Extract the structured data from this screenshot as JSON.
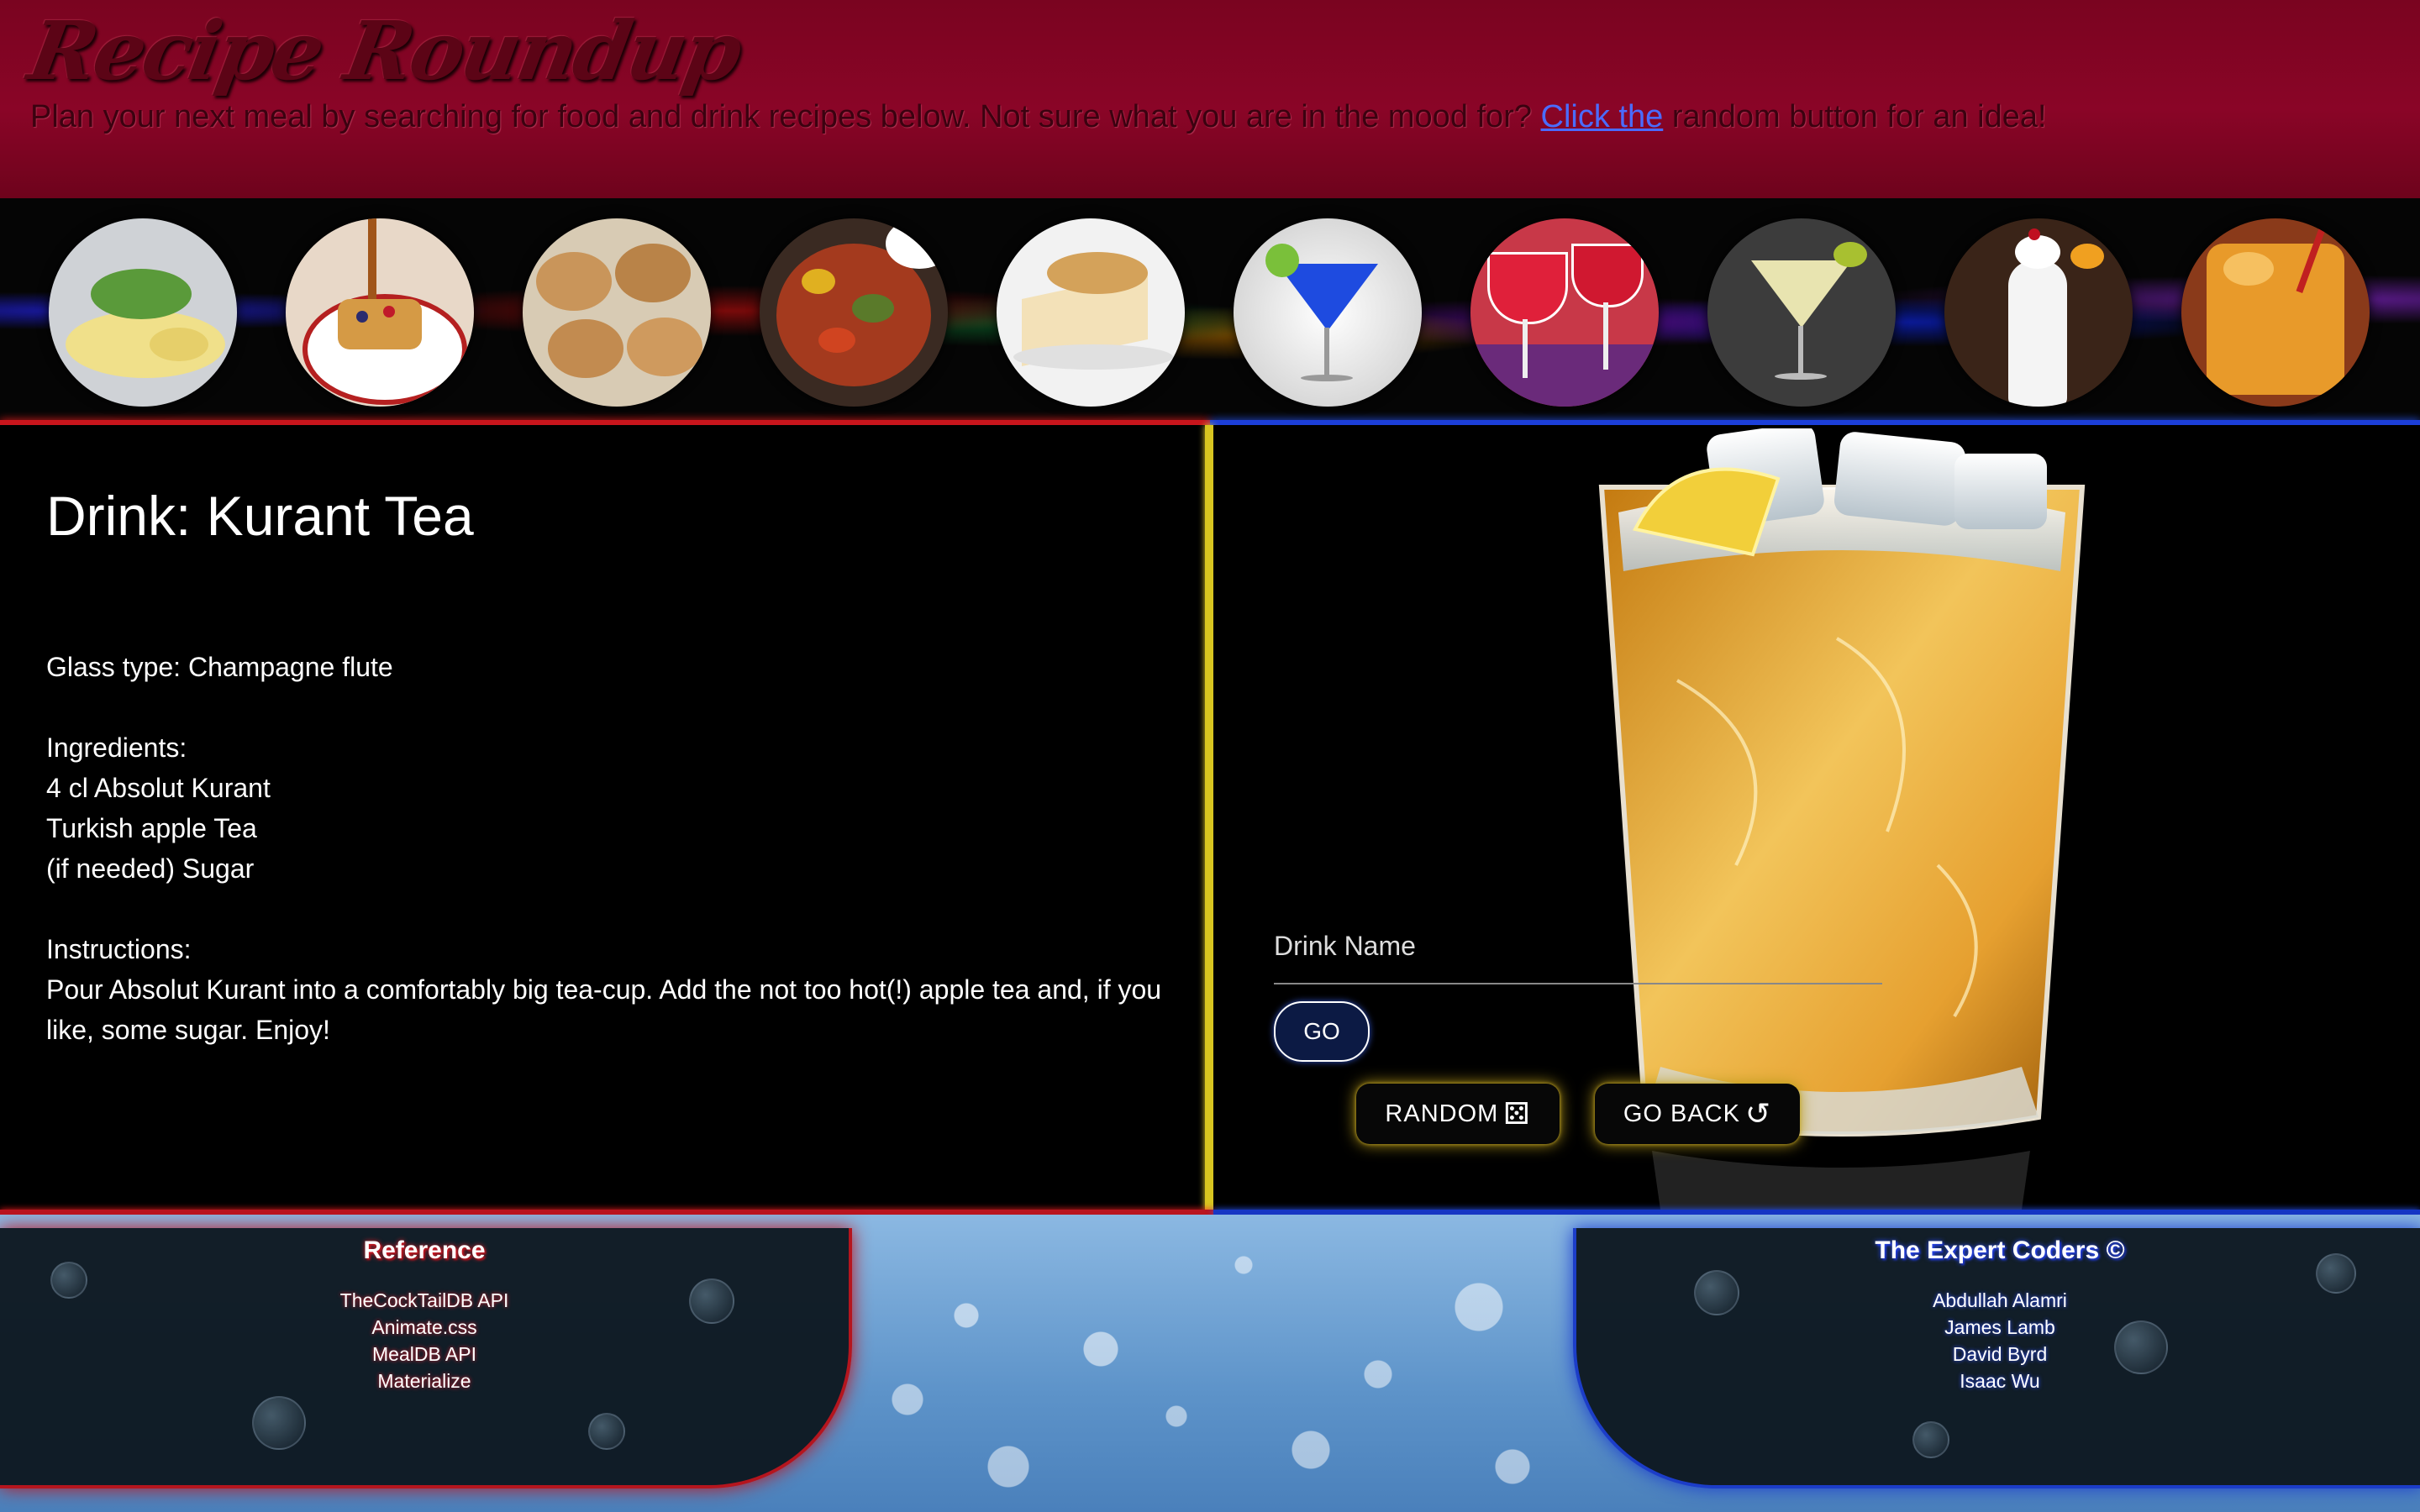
{
  "header": {
    "brand": "Recipe Roundup",
    "tagline_before": "Plan your next meal by searching for food and drink recipes below. Not sure what you are in the mood for? ",
    "tagline_link": "Click the",
    "tagline_after": " random button for an idea!"
  },
  "gallery": {
    "items": [
      {
        "icon": "omelette-image"
      },
      {
        "icon": "pancakes-image"
      },
      {
        "icon": "cookies-image"
      },
      {
        "icon": "roasted-vegetables-image"
      },
      {
        "icon": "cheesecake-image"
      },
      {
        "icon": "blue-martini-image"
      },
      {
        "icon": "red-margarita-image"
      },
      {
        "icon": "lemon-martini-image"
      },
      {
        "icon": "pina-colada-image"
      },
      {
        "icon": "orange-cocktail-image"
      }
    ]
  },
  "drink": {
    "title": "Drink: Kurant Tea",
    "glass_type": "Glass type: Champagne flute",
    "ingredients_heading": "Ingredients:",
    "ingredients": [
      "4 cl Absolut Kurant",
      "Turkish apple Tea",
      "(if needed) Sugar"
    ],
    "instructions_heading": "Instructions:",
    "instructions": "Pour Absolut Kurant into a comfortably big tea-cup. Add the not too hot(!) apple tea and, if you like, some sugar. Enjoy!"
  },
  "search": {
    "label": "Drink Name",
    "value": "",
    "go_label": "GO",
    "random_label": "RANDOM",
    "random_icon": "dice-icon",
    "back_label": "GO BACK",
    "back_icon": "undo-icon"
  },
  "footer": {
    "reference": {
      "title": "Reference",
      "items": [
        "TheCockTailDB API",
        "Animate.css",
        "MealDB API",
        "Materialize"
      ]
    },
    "team": {
      "title": "The Expert Coders ©",
      "items": [
        "Abdullah Alamri",
        "James Lamb",
        "David Byrd",
        "Isaac Wu"
      ]
    }
  },
  "colors": {
    "header_bg": "#8a0527",
    "accent_red": "#c8151c",
    "accent_blue": "#1c3fd9",
    "divider_yellow": "#d8c520",
    "button_glow": "#b79a18"
  }
}
